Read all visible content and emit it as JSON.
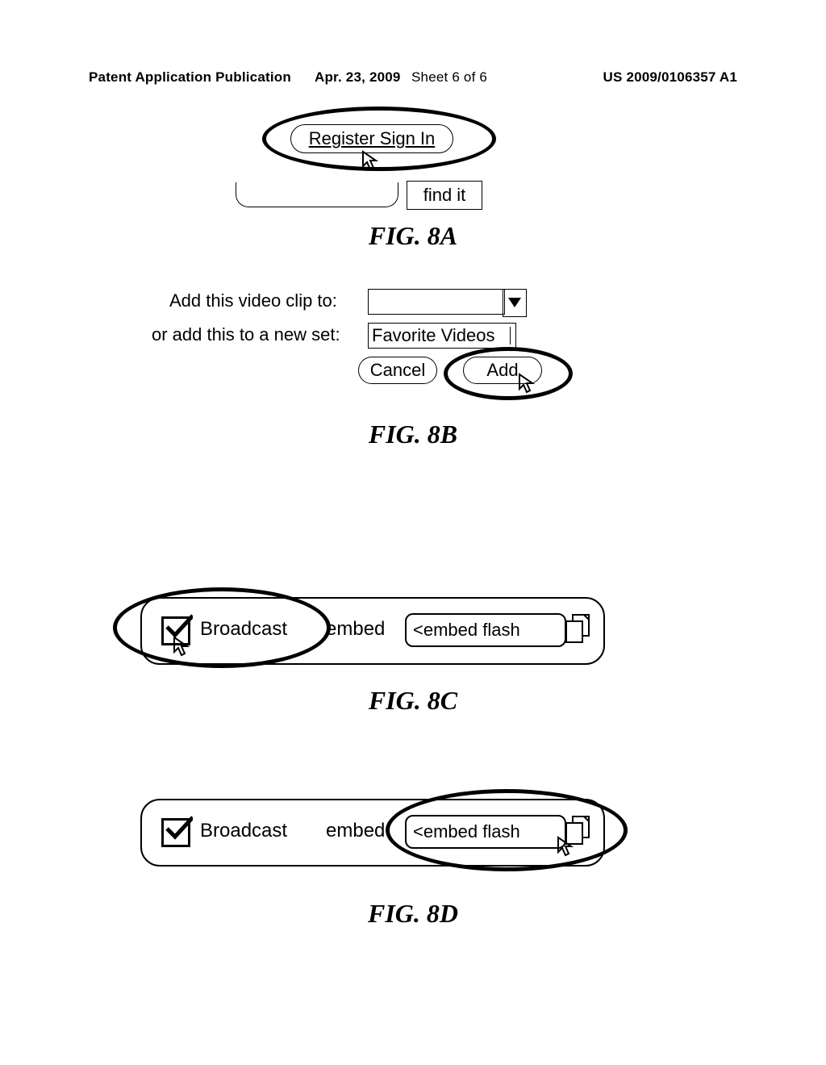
{
  "header": {
    "publication_label": "Patent Application Publication",
    "date": "Apr. 23, 2009",
    "sheet": "Sheet 6 of 6",
    "pub_number": "US 2009/0106357 A1"
  },
  "fig8a": {
    "register_label": "Register Sign In",
    "findit_label": "find it",
    "caption": "FIG. 8A"
  },
  "fig8b": {
    "line1_label": "Add this video clip to:",
    "line2_label": "or add this to a new set:",
    "newset_value": "Favorite Videos",
    "cancel_label": "Cancel",
    "add_label": "Add",
    "caption": "FIG. 8B"
  },
  "fig8c": {
    "broadcast_label": "Broadcast",
    "embed_label": "embed",
    "embed_value": "<embed flash",
    "caption": "FIG. 8C"
  },
  "fig8d": {
    "broadcast_label": "Broadcast",
    "embed_label": "embed",
    "embed_value": "<embed flash",
    "caption": "FIG. 8D"
  }
}
